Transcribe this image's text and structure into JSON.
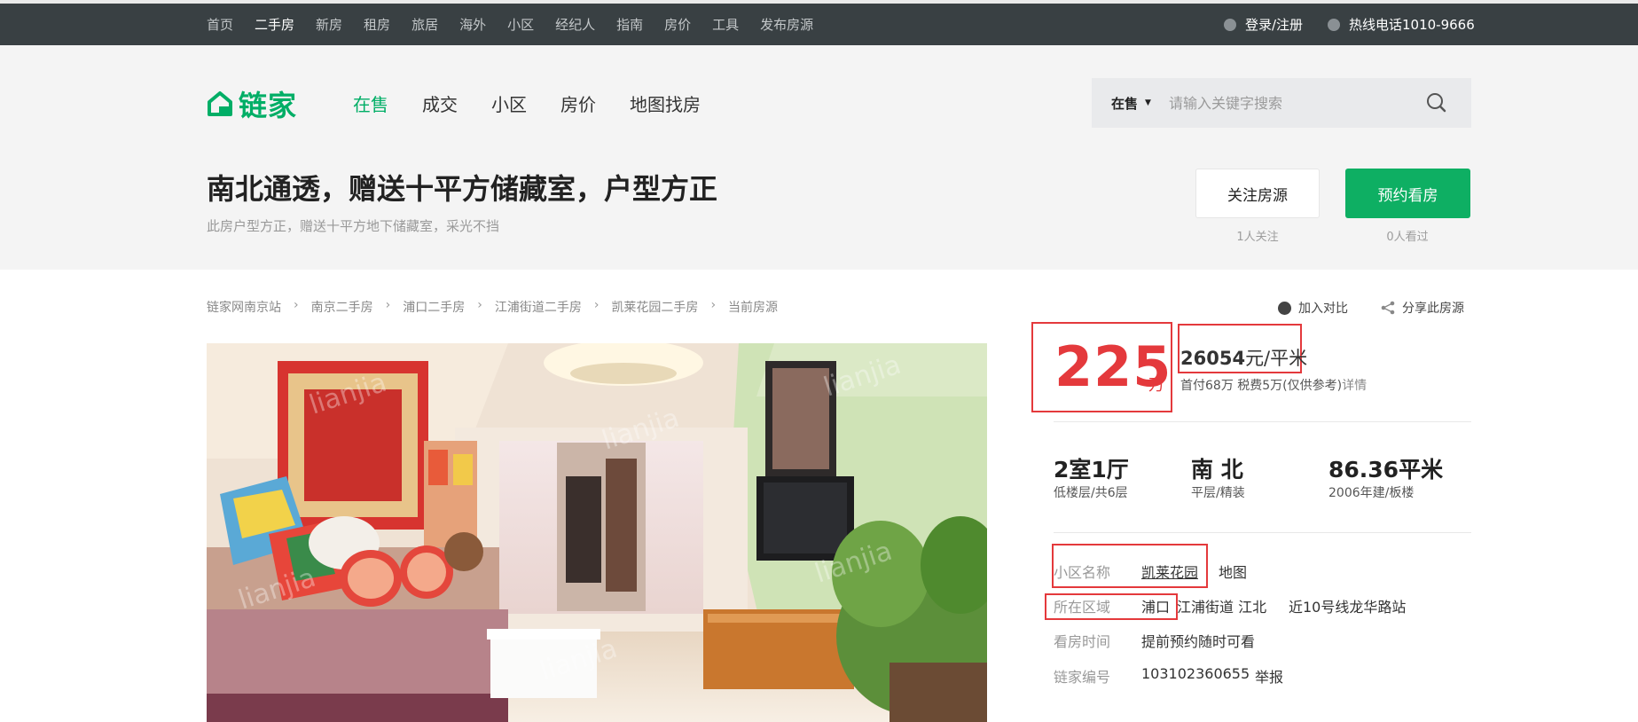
{
  "topbar": {
    "nav": [
      "首页",
      "二手房",
      "新房",
      "租房",
      "旅居",
      "海外",
      "小区",
      "经纪人",
      "指南",
      "房价",
      "工具",
      "发布房源"
    ],
    "active_index": 1,
    "login": "登录/注册",
    "hotline": "热线电话1010-9666"
  },
  "header": {
    "logo_text": "链家",
    "nav": [
      "在售",
      "成交",
      "小区",
      "房价",
      "地图找房"
    ],
    "active_index": 0,
    "search": {
      "type": "在售",
      "placeholder": "请输入关键字搜索"
    }
  },
  "listing": {
    "title": "南北通透，赠送十平方储藏室，户型方正",
    "subtitle": "此房户型方正，赠送十平方地下储藏室，采光不挡",
    "follow_button": "关注房源",
    "follow_count": "1人关注",
    "visit_button": "预约看房",
    "visit_count": "0人看过"
  },
  "breadcrumb": [
    "链家网南京站",
    "南京二手房",
    "浦口二手房",
    "江浦街道二手房",
    "凯莱花园二手房",
    "当前房源"
  ],
  "actions": {
    "compare": "加入对比",
    "share": "分享此房源"
  },
  "price": {
    "total": "225",
    "total_unit": "万",
    "unit_price": "26054",
    "unit_price_suffix": "元/平米",
    "downpayment": "首付68万 税费5万(仅供参考)",
    "detail": "详情"
  },
  "specs": [
    {
      "main": "2室1厅",
      "sub": "低楼层/共6层"
    },
    {
      "main": "南 北",
      "sub": "平层/精装"
    },
    {
      "main": "86.36平米",
      "sub": "2006年建/板楼"
    }
  ],
  "info": {
    "community_label": "小区名称",
    "community": "凯莱花园",
    "map": "地图",
    "area_label": "所在区域",
    "district": "浦口",
    "area_rest": "江浦街道 江北",
    "subway": "近10号线龙华路站",
    "viewing_label": "看房时间",
    "viewing": "提前预约随时可看",
    "id_label": "链家编号",
    "id": "103102360655",
    "report": "举报"
  },
  "watermark": "lianjia",
  "colors": {
    "brand_green": "#00ae66",
    "price_red": "#e4393c",
    "topbar": "#394043"
  }
}
